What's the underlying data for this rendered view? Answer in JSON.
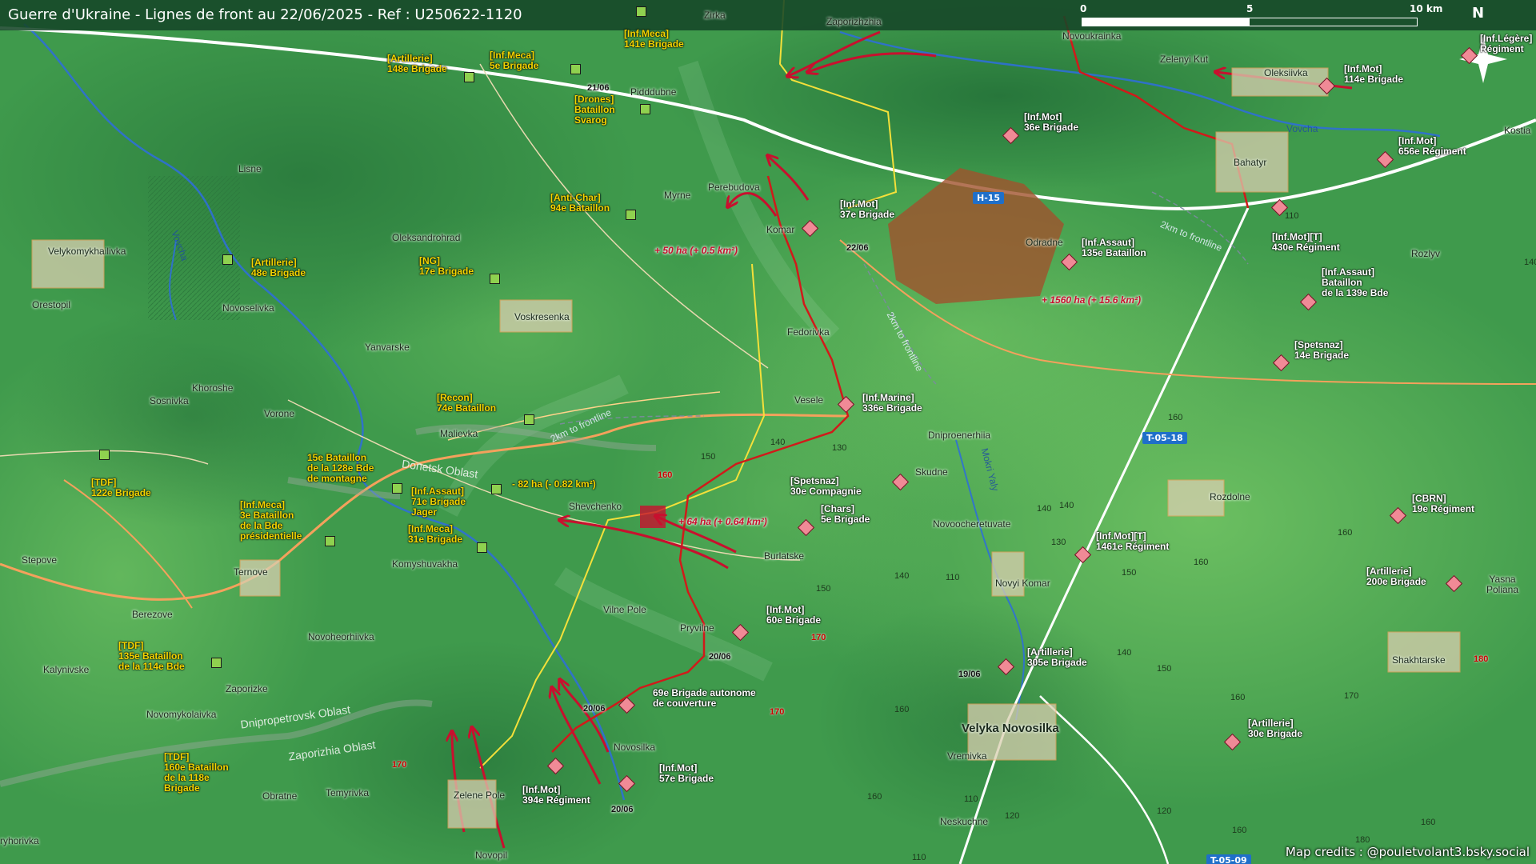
{
  "header": {
    "title": "Guerre d'Ukraine - Lignes de front au 22/06/2025 - Ref : U250622-1120",
    "scale": {
      "s0": "0",
      "s5": "5",
      "s10": "10 km"
    },
    "north": "N"
  },
  "credits": "Map credits : @pouletvolant3.bsky.social",
  "colors": {
    "frontline": "#d11a1a",
    "russian_attack": "#c8102e",
    "ukrainian_units": "#f5d400",
    "roads": "#f4a15c",
    "gain_zone": "#a0522d",
    "terrain": "#3f9a4c"
  },
  "places": [
    {
      "name": "Zaporizhzhia",
      "big": false
    },
    {
      "name": "Zirka",
      "big": false
    },
    {
      "name": "Novoukrainka",
      "big": false
    },
    {
      "name": "Zelenyi Kut",
      "big": false
    },
    {
      "name": "Oleksiivka",
      "big": false
    },
    {
      "name": "Pidddubne",
      "big": false
    },
    {
      "name": "Lisne",
      "big": false
    },
    {
      "name": "Perebudova",
      "big": false
    },
    {
      "name": "Myrne",
      "big": false
    },
    {
      "name": "Komar",
      "big": false
    },
    {
      "name": "Bahatyr",
      "big": false
    },
    {
      "name": "Odradne",
      "big": false
    },
    {
      "name": "Rozlyv",
      "big": false
    },
    {
      "name": "Velykomykhailivka",
      "big": false
    },
    {
      "name": "Oleksandrohrad",
      "big": false
    },
    {
      "name": "Orestopil",
      "big": false
    },
    {
      "name": "Novoselivka",
      "big": false
    },
    {
      "name": "Voskresenka",
      "big": false
    },
    {
      "name": "Yanvarske",
      "big": false
    },
    {
      "name": "Fedorivka",
      "big": false
    },
    {
      "name": "Khoroshe",
      "big": false
    },
    {
      "name": "Sosnivka",
      "big": false
    },
    {
      "name": "Vorone",
      "big": false
    },
    {
      "name": "Malievka",
      "big": false
    },
    {
      "name": "Vesele",
      "big": false
    },
    {
      "name": "Dniproenerhiia",
      "big": false
    },
    {
      "name": "Skudne",
      "big": false
    },
    {
      "name": "Shevchenko",
      "big": false
    },
    {
      "name": "Rozdolne",
      "big": false
    },
    {
      "name": "Novoocheretuvate",
      "big": false
    },
    {
      "name": "Stepove",
      "big": false
    },
    {
      "name": "Komyshuvakha",
      "big": false
    },
    {
      "name": "Burlatske",
      "big": false
    },
    {
      "name": "Ternove",
      "big": false
    },
    {
      "name": "Novyi Komar",
      "big": false
    },
    {
      "name": "Yasna Poliana",
      "big": false
    },
    {
      "name": "Berezove",
      "big": false
    },
    {
      "name": "Vilne Pole",
      "big": false
    },
    {
      "name": "Pryvilne",
      "big": false
    },
    {
      "name": "Novoheorhiivka",
      "big": false
    },
    {
      "name": "Kalynivske",
      "big": false
    },
    {
      "name": "Zaporizke",
      "big": false
    },
    {
      "name": "Shakhtarske",
      "big": false
    },
    {
      "name": "Novomykolaivka",
      "big": false
    },
    {
      "name": "Velyka Novosilka",
      "big": true
    },
    {
      "name": "Vremivka",
      "big": false
    },
    {
      "name": "Novosilka",
      "big": false
    },
    {
      "name": "Temyrivka",
      "big": false
    },
    {
      "name": "Obratne",
      "big": false
    },
    {
      "name": "Zelene Pole",
      "big": false
    },
    {
      "name": "Neskuchne",
      "big": false
    },
    {
      "name": "Novopil",
      "big": false
    },
    {
      "name": "Kostia",
      "big": false
    },
    {
      "name": "ryhorivka",
      "big": false
    }
  ],
  "rivers": [
    "Vovcha",
    "Vovcha",
    "Mokri Yaly"
  ],
  "oblasts": [
    "Donetsk Oblast",
    "Dnipropetrovsk Oblast",
    "Zaporizhia Oblast"
  ],
  "frontline_hints": [
    "2km to frontline",
    "2km to frontline",
    "2km to frontline"
  ],
  "road_badges": [
    "H-15",
    "T-05-18",
    "T-05-09"
  ],
  "ukrainian_units": [
    {
      "l1": "[Artillerie]",
      "l2": "148e Brigade"
    },
    {
      "l1": "[Inf.Meca]",
      "l2": "5e Brigade"
    },
    {
      "l1": "[Inf.Meca]",
      "l2": "141e Brigade"
    },
    {
      "l1": "[Drones]",
      "l2": "Bataillon",
      "l3": "Svarog"
    },
    {
      "l1": "[Anti-Char]",
      "l2": "94e Bataillon"
    },
    {
      "l1": "[Artillerie]",
      "l2": "48e Brigade"
    },
    {
      "l1": "[NG]",
      "l2": "17e Brigade"
    },
    {
      "l1": "[Recon]",
      "l2": "74e Bataillon"
    },
    {
      "l1": "15e Bataillon",
      "l2": "de la 128e Bde",
      "l3": "de montagne"
    },
    {
      "l1": "[TDF]",
      "l2": "122e Brigade"
    },
    {
      "l1": "[Inf.Assaut]",
      "l2": "71e Brigade",
      "l3": "Jager"
    },
    {
      "l1": "[Inf.Meca]",
      "l2": "3e Bataillon",
      "l3": "de la Bde",
      "l4": "présidentielle"
    },
    {
      "l1": "[Inf.Meca]",
      "l2": "31e Brigade"
    },
    {
      "l1": "[TDF]",
      "l2": "135e Bataillon",
      "l3": "de la 114e Bde"
    },
    {
      "l1": "[TDF]",
      "l2": "160e Bataillon",
      "l3": "de la 118e",
      "l4": "Brigade"
    }
  ],
  "russian_units": [
    {
      "l1": "[Inf.Légère]",
      "l2": "Régiment"
    },
    {
      "l1": "[Inf.Mot]",
      "l2": "114e Brigade"
    },
    {
      "l1": "[Inf.Mot]",
      "l2": "36e Brigade"
    },
    {
      "l1": "[Inf.Mot]",
      "l2": "656e Régiment"
    },
    {
      "l1": "[Inf.Mot]",
      "l2": "37e Brigade"
    },
    {
      "l1": "[Inf.Assaut]",
      "l2": "135e Bataillon"
    },
    {
      "l1": "[Inf.Mot][T]",
      "l2": "430e Régiment"
    },
    {
      "l1": "[Inf.Assaut]",
      "l2": "Bataillon",
      "l3": "de la 139e Bde"
    },
    {
      "l1": "[Spetsnaz]",
      "l2": "14e Brigade"
    },
    {
      "l1": "[Inf.Marine]",
      "l2": "336e Brigade"
    },
    {
      "l1": "[Spetsnaz]",
      "l2": "30e Compagnie"
    },
    {
      "l1": "[Chars]",
      "l2": "5e Brigade"
    },
    {
      "l1": "[CBRN]",
      "l2": "19e Régiment"
    },
    {
      "l1": "[Inf.Mot][T]",
      "l2": "1461e Régiment"
    },
    {
      "l1": "[Artillerie]",
      "l2": "200e Brigade"
    },
    {
      "l1": "[Inf.Mot]",
      "l2": "60e Brigade"
    },
    {
      "l1": "[Artillerie]",
      "l2": "305e Brigade"
    },
    {
      "l1": "69e Brigade autonome",
      "l2": "de couverture"
    },
    {
      "l1": "[Artillerie]",
      "l2": "30e Brigade"
    },
    {
      "l1": "[Inf.Mot]",
      "l2": "57e Brigade"
    },
    {
      "l1": "[Inf.Mot]",
      "l2": "394e Régiment"
    }
  ],
  "gains": [
    {
      "text": "+ 50 ha (+ 0.5 km²)",
      "side": "ru"
    },
    {
      "text": "+ 1560 ha (+ 15.6 km²)",
      "side": "ru"
    },
    {
      "text": "- 82 ha (- 0.82 km²)",
      "side": "ua"
    },
    {
      "text": "+ 64 ha (+ 0.64 km²)",
      "side": "ru"
    }
  ],
  "dates": [
    "21/06",
    "22/06",
    "20/06",
    "20/06",
    "19/06",
    "20/06"
  ],
  "elevations": [
    {
      "v": "110",
      "red": false
    },
    {
      "v": "140",
      "red": false
    },
    {
      "v": "150",
      "red": false
    },
    {
      "v": "140",
      "red": false
    },
    {
      "v": "130",
      "red": false
    },
    {
      "v": "160",
      "red": true
    },
    {
      "v": "160",
      "red": false
    },
    {
      "v": "140",
      "red": false
    },
    {
      "v": "130",
      "red": false
    },
    {
      "v": "150",
      "red": false
    },
    {
      "v": "160",
      "red": false
    },
    {
      "v": "160",
      "red": false
    },
    {
      "v": "140",
      "red": false
    },
    {
      "v": "150",
      "red": false
    },
    {
      "v": "170",
      "red": true
    },
    {
      "v": "110",
      "red": false
    },
    {
      "v": "140",
      "red": false
    },
    {
      "v": "150",
      "red": false
    },
    {
      "v": "170",
      "red": false
    },
    {
      "v": "180",
      "red": true
    },
    {
      "v": "160",
      "red": false
    },
    {
      "v": "170",
      "red": true
    },
    {
      "v": "170",
      "red": true
    },
    {
      "v": "160",
      "red": false
    },
    {
      "v": "160",
      "red": false
    },
    {
      "v": "110",
      "red": false
    },
    {
      "v": "120",
      "red": false
    },
    {
      "v": "110",
      "red": false
    },
    {
      "v": "120",
      "red": false
    },
    {
      "v": "160",
      "red": false
    },
    {
      "v": "180",
      "red": false
    },
    {
      "v": "160",
      "red": false
    },
    {
      "v": "140",
      "red": false
    }
  ]
}
